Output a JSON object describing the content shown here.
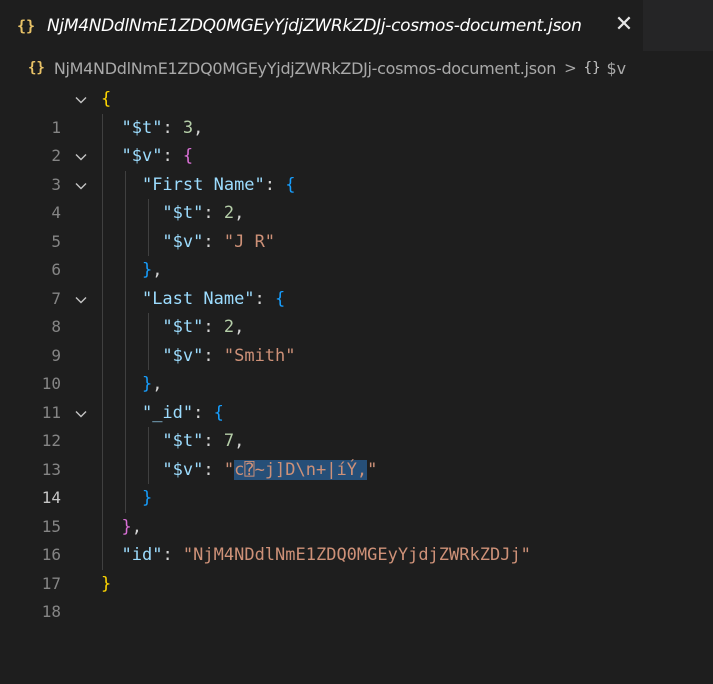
{
  "tab": {
    "icon": "{}",
    "icon_name": "json-braces-icon",
    "title": "NjM4NDdlNmE1ZDQ0MGEyYjdjZWRkZDJj-cosmos-document.json",
    "close": "✕"
  },
  "breadcrumb": {
    "file_icon": "{}",
    "file": "NjM4NDdlNmE1ZDQ0MGEyYjdjZWRkZDJj-cosmos-document.json",
    "separator": ">",
    "symbol_icon": "{}",
    "property": "$v"
  },
  "editor": {
    "active_line": 14,
    "lines": [
      {
        "n": "1"
      },
      {
        "n": "2"
      },
      {
        "n": "3"
      },
      {
        "n": "4"
      },
      {
        "n": "5"
      },
      {
        "n": "6"
      },
      {
        "n": "7"
      },
      {
        "n": "8"
      },
      {
        "n": "9"
      },
      {
        "n": "10"
      },
      {
        "n": "11"
      },
      {
        "n": "12"
      },
      {
        "n": "13"
      },
      {
        "n": "14"
      },
      {
        "n": "15"
      },
      {
        "n": "16"
      },
      {
        "n": "17"
      },
      {
        "n": "18"
      }
    ],
    "text": {
      "open_brace": "{",
      "close_brace": "}",
      "close_brace_comma": "},",
      "colon": ": ",
      "comma": ",",
      "key_t": "\"$t\"",
      "key_v": "\"$v\"",
      "key_first_name": "\"First Name\"",
      "key_last_name": "\"Last Name\"",
      "key__id": "\"_id\"",
      "key_id": "\"id\"",
      "num_3": "3",
      "num_2": "2",
      "num_7": "7",
      "val_first": "\"J R\"",
      "val_last": "\"Smith\"",
      "val_oid_quote": "\"",
      "val_oid_selected": "c⍰~j]D\\n+|íÝ,",
      "val_oid_end": "\"",
      "val_id": "\"NjM4NDdlNmE1ZDQ0MGEyYjdjZWRkZDJj\""
    }
  }
}
